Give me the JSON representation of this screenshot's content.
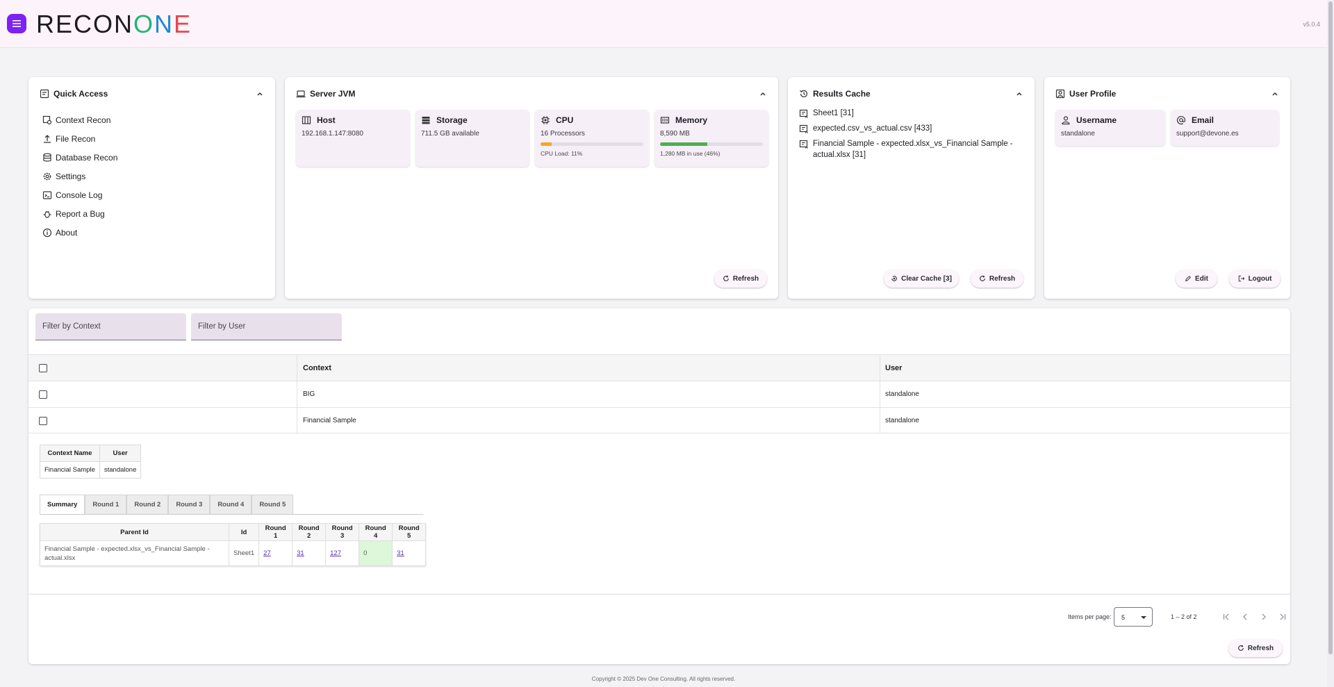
{
  "app": {
    "logo": {
      "p1": "RECON",
      "p2": "O",
      "p3": "N",
      "p4": "E"
    },
    "version": "v5.0.4"
  },
  "quick_access": {
    "title": "Quick Access",
    "items": [
      {
        "label": "Context Recon",
        "icon": "context-recon-icon"
      },
      {
        "label": "File Recon",
        "icon": "upload-icon"
      },
      {
        "label": "Database Recon",
        "icon": "database-icon"
      },
      {
        "label": "Settings",
        "icon": "gear-icon"
      },
      {
        "label": "Console Log",
        "icon": "terminal-icon"
      },
      {
        "label": "Report a Bug",
        "icon": "bug-icon"
      },
      {
        "label": "About",
        "icon": "info-icon"
      }
    ]
  },
  "server_jvm": {
    "title": "Server JVM",
    "host": {
      "label": "Host",
      "value": "192.168.1.147:8080"
    },
    "storage": {
      "label": "Storage",
      "value": "711.5 GB available"
    },
    "cpu": {
      "label": "CPU",
      "value": "16 Processors",
      "load_text": "CPU Load: 11%",
      "load_fraction": 0.11,
      "bar_color": "#f5a623"
    },
    "memory": {
      "label": "Memory",
      "value": "8,590 MB",
      "usage_text": "1,280 MB in use (46%)",
      "usage_fraction": 0.46,
      "bar_color": "#4caf50"
    },
    "refresh_label": "Refresh"
  },
  "results_cache": {
    "title": "Results Cache",
    "items": [
      "Sheet1 [31]",
      "expected.csv_vs_actual.csv [433]",
      "Financial Sample - expected.xlsx_vs_Financial Sample - actual.xlsx [31]"
    ],
    "clear_label": "Clear Cache [3]",
    "refresh_label": "Refresh"
  },
  "user_profile": {
    "title": "User Profile",
    "username": {
      "label": "Username",
      "value": "standalone"
    },
    "email": {
      "label": "Email",
      "value": "support@devone.es"
    },
    "edit_label": "Edit",
    "logout_label": "Logout"
  },
  "filters": {
    "context_placeholder": "Filter by Context",
    "user_placeholder": "Filter by User"
  },
  "grid": {
    "headers": {
      "context": "Context",
      "user": "User"
    },
    "rows": [
      {
        "context": "BIG",
        "user": "standalone"
      },
      {
        "context": "Financial Sample",
        "user": "standalone"
      }
    ]
  },
  "detail": {
    "info_headers": {
      "name": "Context Name",
      "user": "User"
    },
    "info_values": {
      "name": "Financial Sample",
      "user": "standalone"
    },
    "tabs": [
      "Summary",
      "Round 1",
      "Round 2",
      "Round 3",
      "Round 4",
      "Round 5"
    ],
    "summary_headers": [
      "Parent Id",
      "Id",
      "Round 1",
      "Round 2",
      "Round 3",
      "Round 4",
      "Round 5"
    ],
    "summary_row": {
      "parent_id": "Financial Sample - expected.xlsx_vs_Financial Sample - actual.xlsx",
      "id": "Sheet1",
      "r1": "27",
      "r2": "31",
      "r3": "127",
      "r4": "0",
      "r5": "31"
    }
  },
  "paginator": {
    "items_per_page_label": "Items per page:",
    "items_per_page": "5",
    "range": "1 – 2 of 2",
    "refresh_label": "Refresh"
  },
  "footer": {
    "copyright": "Copyright © 2025 Dev One Consulting. All rights reserved."
  }
}
